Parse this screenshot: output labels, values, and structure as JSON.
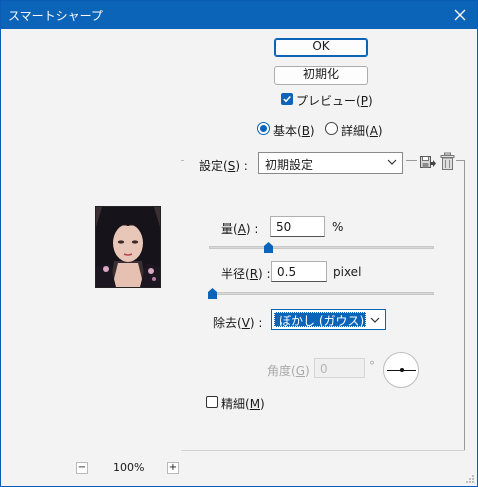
{
  "window": {
    "title": "スマートシャープ"
  },
  "buttons": {
    "ok": "OK",
    "reset": "初期化"
  },
  "preview": {
    "label": "プレビュー(",
    "key": "P",
    "close": ")",
    "checked": true
  },
  "mode": {
    "basic": {
      "label": "基本(",
      "key": "B",
      "close": ")",
      "selected": true
    },
    "advanced": {
      "label": "詳細(",
      "key": "A",
      "close": ")",
      "selected": false
    }
  },
  "settings": {
    "label": "設定(",
    "key": "S",
    "close": ") :",
    "value": "初期設定"
  },
  "amount": {
    "label": "量(",
    "key": "A",
    "close": ") :",
    "value": "50",
    "unit": "%",
    "slider_fraction": 0.25
  },
  "radius": {
    "label": "半径(",
    "key": "R",
    "close": ") :",
    "value": "0.5",
    "unit": "pixel",
    "slider_fraction": 0.0
  },
  "remove": {
    "label": "除去(",
    "key": "V",
    "close": ") :",
    "value": "ぼかし (ガウス)"
  },
  "angle": {
    "label": "角度(",
    "key": "G",
    "close": ") :",
    "value": "0",
    "unit": "°"
  },
  "more_accurate": {
    "label": "精細(",
    "key": "M",
    "close": ")",
    "checked": false
  },
  "zoom": {
    "minus": "−",
    "value": "100%",
    "plus": "+"
  },
  "colors": {
    "accent": "#0b64b8",
    "titlebar": "#0b64b8"
  }
}
